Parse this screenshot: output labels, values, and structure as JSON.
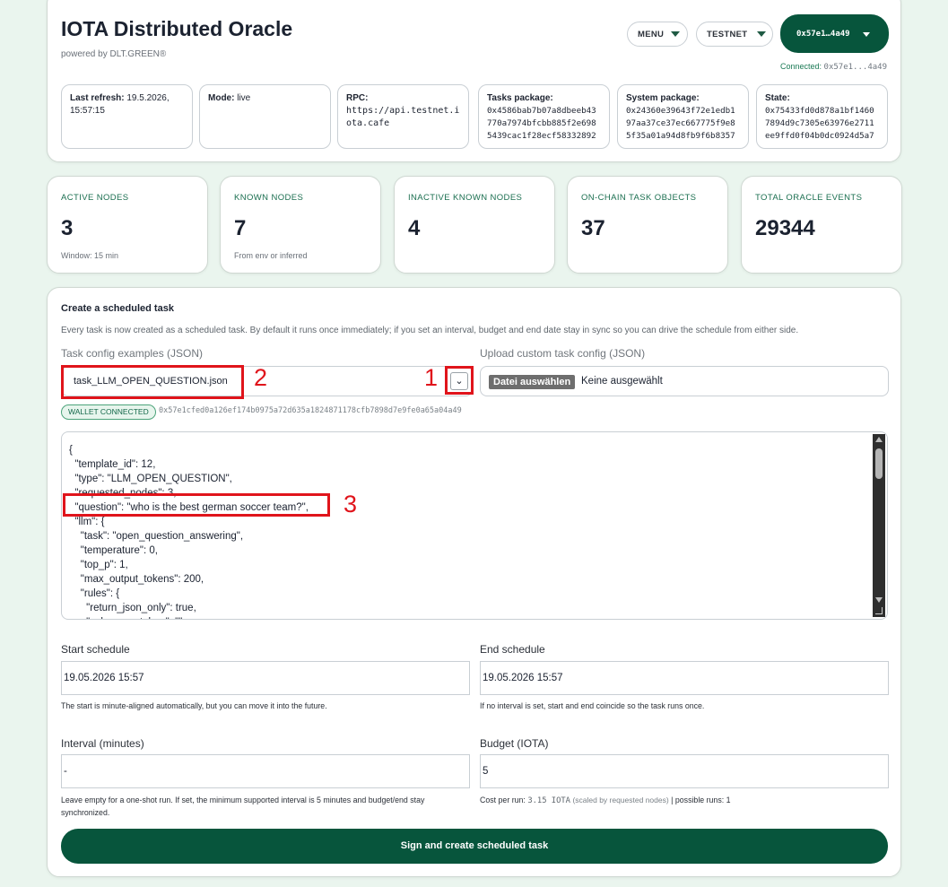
{
  "header": {
    "title": "IOTA Distributed Oracle",
    "subtitle": "powered by DLT.GREEN®",
    "menu_label": "MENU",
    "network_label": "TESTNET",
    "wallet_label": "0x57e1…4a49",
    "connected_label": "Connected:",
    "connected_address": "0x57e1...4a49",
    "info": {
      "last_refresh_label": "Last refresh:",
      "last_refresh_value": "19.5.2026, 15:57:15",
      "mode_label": "Mode:",
      "mode_value": "live",
      "rpc_label": "RPC:",
      "rpc_value": "https://api.testnet.iota.cafe",
      "tasks_label": "Tasks package:",
      "tasks_value": "0x4586bab7b07a8dbeeb43770a7974bfcbb885f2e6985439cac1f28ecf58332892",
      "system_label": "System package:",
      "system_value": "0x24360e39643f72e1edb197aa37ce37ec667775f9e85f35a01a94d8fb9f6b8357",
      "state_label": "State:",
      "state_value": "0x75433fd0d878a1bf14607894d9c7305e63976e2711ee9ffd0f04b0dc0924d5a7"
    }
  },
  "stats": [
    {
      "label": "ACTIVE NODES",
      "value": "3",
      "note": "Window: 15 min"
    },
    {
      "label": "KNOWN NODES",
      "value": "7",
      "note": "From env or inferred"
    },
    {
      "label": "INACTIVE KNOWN NODES",
      "value": "4",
      "note": ""
    },
    {
      "label": "ON-CHAIN TASK OBJECTS",
      "value": "37",
      "note": ""
    },
    {
      "label": "TOTAL ORACLE EVENTS",
      "value": "29344",
      "note": ""
    }
  ],
  "form": {
    "title": "Create a scheduled task",
    "description": "Every task is now created as a scheduled task. By default it runs once immediately; if you set an interval, budget and end date stay in sync so you can drive the schedule from either side.",
    "examples_label": "Task config examples (JSON)",
    "examples_selected": "task_LLM_OPEN_QUESTION.json",
    "upload_label": "Upload custom task config (JSON)",
    "upload_button": "Datei auswählen",
    "upload_none": "Keine ausgewählt",
    "wallet_badge": "WALLET CONNECTED",
    "wallet_address": "0x57e1cfed0a126ef174b0975a72d635a1824871178cfb7898d7e9fe0a65a04a49",
    "json_text": "{\n  \"template_id\": 12,\n  \"type\": \"LLM_OPEN_QUESTION\",\n  \"requested_nodes\": 3,\n  \"question\": \"who is the best german soccer team?\",\n  \"llm\": {\n    \"task\": \"open_question_answering\",\n    \"temperature\": 0,\n    \"top_p\": 1,\n    \"max_output_tokens\": 200,\n    \"rules\": {\n      \"return_json_only\": true,\n      \"value_must_be_\": \"\"",
    "start_label": "Start schedule",
    "start_value": "19.05.2026  15:57",
    "start_hint": "The start is minute-aligned automatically, but you can move it into the future.",
    "end_label": "End schedule",
    "end_value": "19.05.2026  15:57",
    "end_hint": "If no interval is set, start and end coincide so the task runs once.",
    "interval_label": "Interval (minutes)",
    "interval_value": "-",
    "interval_hint": "Leave empty for a one-shot run. If set, the minimum supported interval is 5 minutes and budget/end stay synchronized.",
    "budget_label": "Budget (IOTA)",
    "budget_value": "5",
    "cost_label": "Cost per run:",
    "cost_value": "3.15 IOTA",
    "cost_scaled": "(scaled by requested nodes)",
    "cost_runs": "| possible runs: 1",
    "submit_label": "Sign and create scheduled task"
  },
  "annotations": {
    "one": "1",
    "two": "2",
    "three": "3"
  },
  "colors": {
    "accent": "#07553c",
    "page_bg": "#eaf5ee",
    "annotation": "#e0141b"
  }
}
